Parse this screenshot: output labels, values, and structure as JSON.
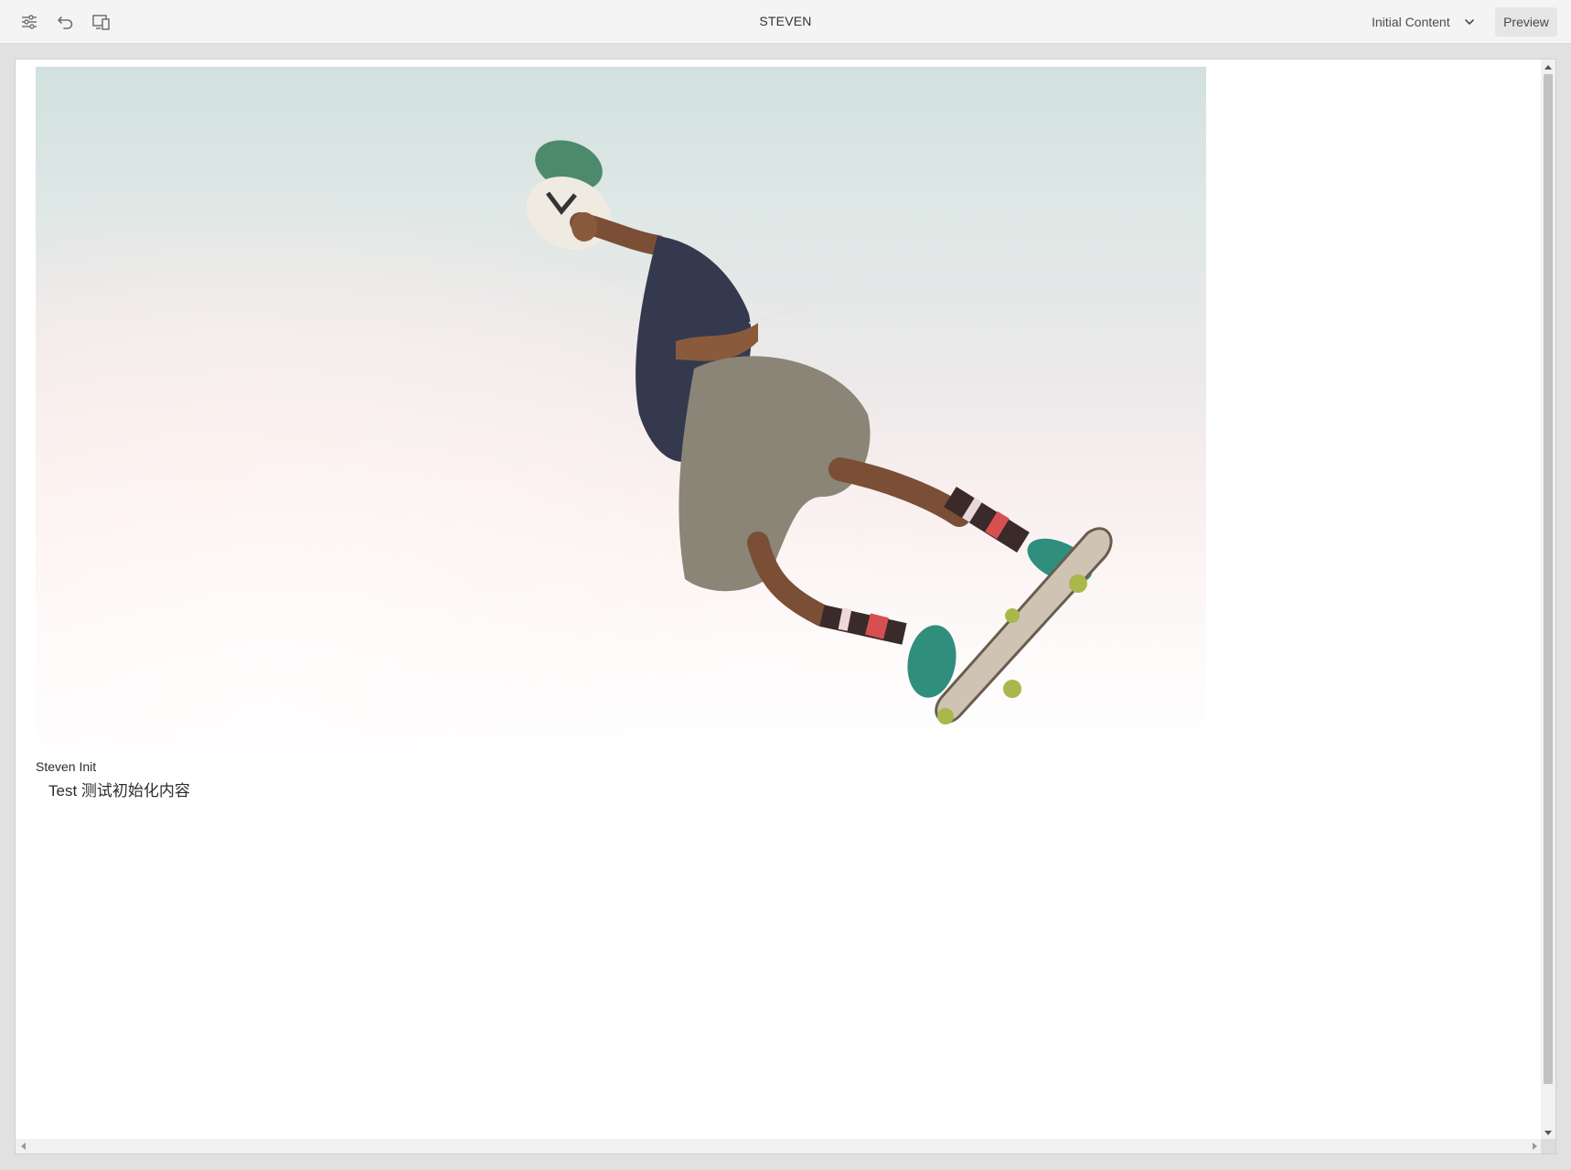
{
  "toolbar": {
    "title": "STEVEN",
    "icons": [
      "settings-sliders-icon",
      "undo-icon",
      "device-preview-icon",
      "chevron-down-icon"
    ],
    "mode_select": {
      "selected": "Initial Content"
    },
    "preview_label": "Preview"
  },
  "content": {
    "caption_title": "Steven Init",
    "caption_text": "Test 测试初始化内容"
  },
  "colors": {
    "toolbar_bg": "#f4f4f4",
    "page_bg": "#e1e1e1",
    "preview_button_bg": "#e6e6e6"
  }
}
